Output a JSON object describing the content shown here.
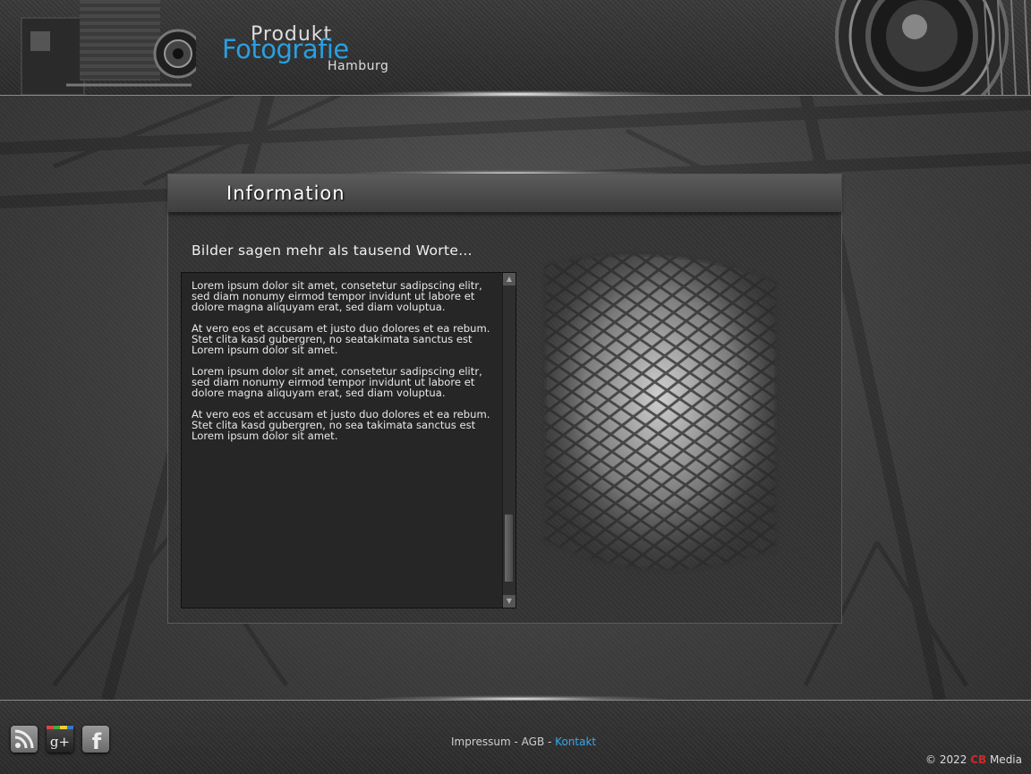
{
  "logo": {
    "line1": "Produkt",
    "line2": "Fotografie",
    "line3": "Hamburg"
  },
  "panel": {
    "title": "Information",
    "subheading": "Bilder sagen mehr als tausend Worte…",
    "paragraphs": [
      "Lorem ipsum dolor sit amet, consetetur sadipscing elitr, sed diam nonumy eirmod tempor invidunt ut labore et dolore magna aliquyam erat, sed diam voluptua.",
      "At vero eos et accusam et justo duo dolores et ea rebum. Stet clita kasd gubergren, no seatakimata sanctus est Lorem ipsum dolor sit amet.",
      "Lorem ipsum dolor sit amet, consetetur sadipscing elitr, sed diam nonumy eirmod tempor invidunt ut labore et dolore magna aliquyam erat, sed diam voluptua.",
      "At vero eos et accusam et justo duo dolores et ea rebum. Stet clita kasd gubergren, no sea takimata sanctus est Lorem ipsum dolor sit amet."
    ]
  },
  "footer": {
    "links": [
      {
        "label": "Impressum"
      },
      {
        "label": "AGB"
      },
      {
        "label": "Kontakt"
      }
    ],
    "separator": " - ",
    "copyright_prefix": "© 2022 ",
    "copyright_brand": "CB",
    "copyright_suffix": " Media"
  },
  "social_icons": [
    "rss-icon",
    "google-plus-icon",
    "facebook-icon"
  ],
  "colors": {
    "accent": "#2a9fe0",
    "active_link": "#34a8ea",
    "brand_red": "#cc2a2a"
  }
}
